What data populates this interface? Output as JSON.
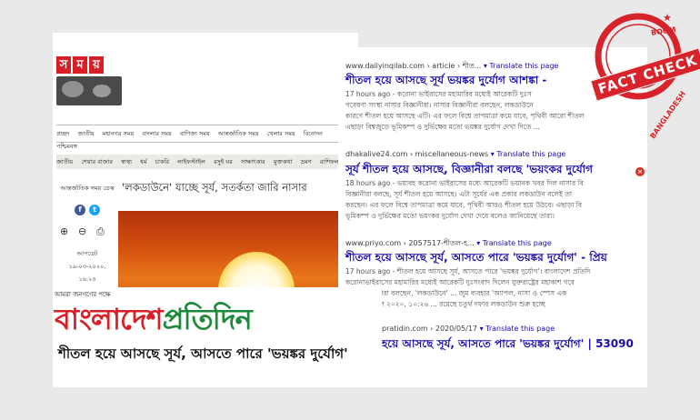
{
  "somoy": {
    "logo_letters": [
      "স",
      "ম",
      "য়"
    ],
    "nav_primary": [
      "প্রচ্ছদ",
      "জাতীয়",
      "মহানগর সময়",
      "বাংলার সময়",
      "বাণিজ্য সময়",
      "আন্তর্জাতিক সময়",
      "খেলার সময়",
      "বিনোদন"
    ],
    "nav_primary_overflow": "পশ্চিমবঙ্গ",
    "nav_secondary": [
      "জাতীয়",
      "শেয়ার বাজার",
      "স্বাস্থ্য",
      "ধর্ম",
      "চাকরি",
      "লাইফস্টাইল",
      "রসুই ঘর",
      "সাক্ষাৎকার",
      "মুক্তকথা",
      "ভ্রমণ",
      "রাশিফল"
    ],
    "sidebar": {
      "heading": "আন্তর্জাতিক সময় ডেস্ক",
      "facebook": "f",
      "twitter": "t",
      "updated_label": "আপডেট",
      "updated_date": "১৯-০৩-২০২০,",
      "updated_time": "১৬:২৪"
    },
    "headline": "'লকডাউনে' যাচ্ছে সূর্য, সতর্কতা জারি নাসার"
  },
  "results": [
    {
      "url": "www.dailyinqilab.com › article › শীত...",
      "translate": "▾ Translate this page",
      "title": "শীতল হয়ে আসছে সূর্য ভয়ঙ্কর দুর্যোগ আশঙ্কা -",
      "snippet": [
        "17 hours ago - করোনা ভাইরাসের মহামারির মধ্যেই আরেকটি দুঃস",
        "গবেষণা সংস্থা নাসার বিজ্ঞানীরা। নাসার বিজ্ঞানীরা বলছেন, লকডাউনে",
        "কারণে শীতল হয়ে আসছে এটি। এর ফলে বিশ্বে তাপমাত্রা কমে যাবে, পৃথিবী আরো শীতল",
        "এছাড়া বিশ্বজুড়ে ভূমিকম্প ও দুর্ভিক্ষের মতো ভয়ঙ্কর দুর্যোগ দেখা দিতে ..."
      ]
    },
    {
      "url": "dhakalive24.com › miscellaneous-news",
      "translate": "▾ Translate this page",
      "title": "সূর্য শীতল হয়ে আসছে, বিজ্ঞানীরা বলছে 'ভয়ংকর দুর্যোগ",
      "snippet": [
        "18 hours ago - ভয়াবহ করোনা ভাইরাসের মধ্যে আরেকটি ভয়ানক খবর দিল নাসার বি",
        "বিজ্ঞানীরা বলছে, সূর্য শীতল হয়ে আসছে। এটা সূর্যের এক প্রকার লকডাউন বলেই তা",
        "করছেন। এর ফলে বিশ্বে তাপমাত্রা কমে যাবে, পৃথিবী আরও শীতল হয়ে উঠবে। এছাড়া বি",
        "ভূমিকম্প ও দুর্ভিক্ষের মতো ভয়ংকর দুর্যোগ দেখা দেবে বলেও জানিয়েছে তারা।"
      ]
    },
    {
      "url": "www.priyo.com › 2057517-শীতল-হ...",
      "translate": "▾ Translate this page",
      "title": "শীতল হয়ে আসছে সূর্য, আসতে পারে 'ভয়ঙ্কর দুর্যোগ' - প্রিয়",
      "snippet": [
        "17 hours ago - শীতল হয়ে আসছে সূর্য, আসতে পারে 'ভয়ঙ্কর দুর্যোগ'। বাংলাদেশ প্রতিদি",
        "করোনাভাইরাসের মহামারির মধ্যেই আরেকটি দুঃসংবাদ দিলেন যুক্তরাষ্ট্রের মহাকাশ গবে",
        "বিজ্ঞানীরা। তারা বলছেন, 'লকডাউনে' ... জুম ব্যবহার 'অ্যাপল, নাসা ও স্পেস এক",
        "মস ০৪ এপ্রিল ২০২০, ১০:২৬ ... রয়েছে চতুর্থ দফার লকডাউন শুরু হচ্ছে"
      ]
    },
    {
      "url": "pratidin.com › 2020/05/17",
      "translate": "▾ Translate this page",
      "title": "হয়ে আসছে সূর্য, আসতে পারে 'ভয়ঙ্কর দুর্যোগ' | 53090",
      "snippet": []
    }
  ],
  "pratidin": {
    "tagline": "আমরা জনগণের পক্ষে",
    "logo_red": "বাংলাদেশ",
    "logo_green": "প্রতিদিন",
    "headline": "শীতল হয়ে আসছে সূর্য, আসতে পারে 'ভয়ঙ্কর দুর্যোগ'"
  },
  "stamp": {
    "boom": "BOOM",
    "fact_check": "FACT CHECK",
    "country": "BANGLADESH"
  },
  "colors": {
    "brand_red": "#d81e27",
    "brand_green": "#1c8a3a",
    "link_blue": "#1a0dab",
    "stamp_red": "#d8232a"
  }
}
